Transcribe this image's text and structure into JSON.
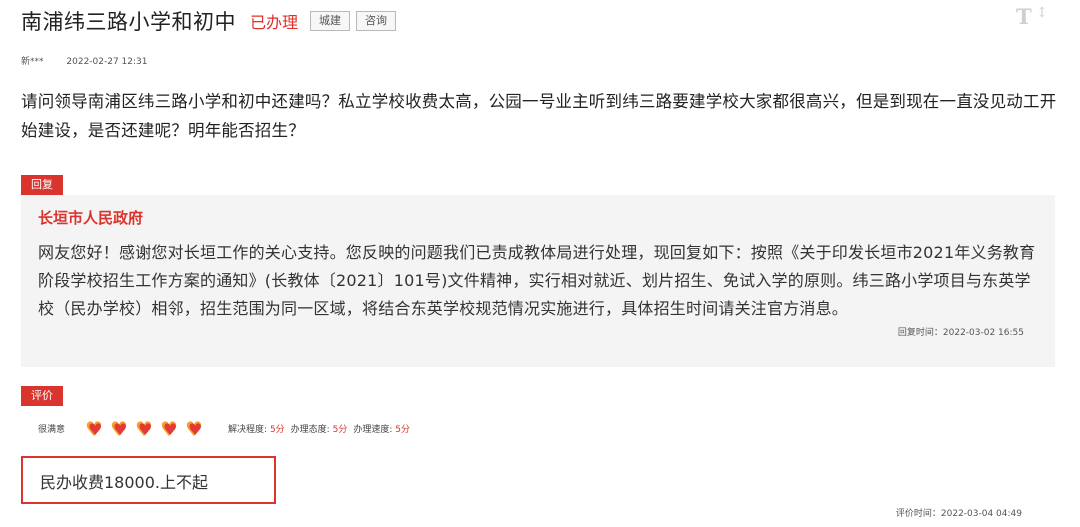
{
  "header": {
    "title": "南浦纬三路小学和初中",
    "status": "已办理",
    "tags": [
      "城建",
      "咨询"
    ],
    "font_toggle_glyph": "T",
    "font_toggle_arrow": "↕"
  },
  "meta": {
    "user": "新***",
    "time": "2022-02-27 12:31"
  },
  "question": "请问领导南浦区纬三路小学和初中还建吗？私立学校收费太高，公园一号业主听到纬三路要建学校大家都很高兴，但是到现在一直没见动工开始建设，是否还建呢？明年能否招生？",
  "reply": {
    "badge": "回复",
    "org": "长垣市人民政府",
    "text": "网友您好！感谢您对长垣工作的关心支持。您反映的问题我们已责成教体局进行处理，现回复如下：按照《关于印发长垣市2021年义务教育阶段学校招生工作方案的通知》(长教体〔2021〕101号)文件精神，实行相对就近、划片招生、免试入学的原则。纬三路小学项目与东英学校（民办学校）相邻，招生范围为同一区域，将结合东英学校规范情况实施进行，具体招生时间请关注官方消息。",
    "time": "回复时间：2022-03-02 16:55"
  },
  "rating": {
    "badge": "评价",
    "satisfaction": "很满意",
    "hearts": 5,
    "scores": [
      {
        "label": "解决程度:",
        "value": "5分"
      },
      {
        "label": "办理态度:",
        "value": "5分"
      },
      {
        "label": "办理速度:",
        "value": "5分"
      }
    ],
    "comment": "民办收费18000.上不起",
    "time": "评价时间：2022-03-04 04:49"
  },
  "colors": {
    "accent_red": "#d9342d",
    "heart_orange": "#f5a02a",
    "heart_red": "#e23a35",
    "reply_bg": "#f4f4f4"
  }
}
